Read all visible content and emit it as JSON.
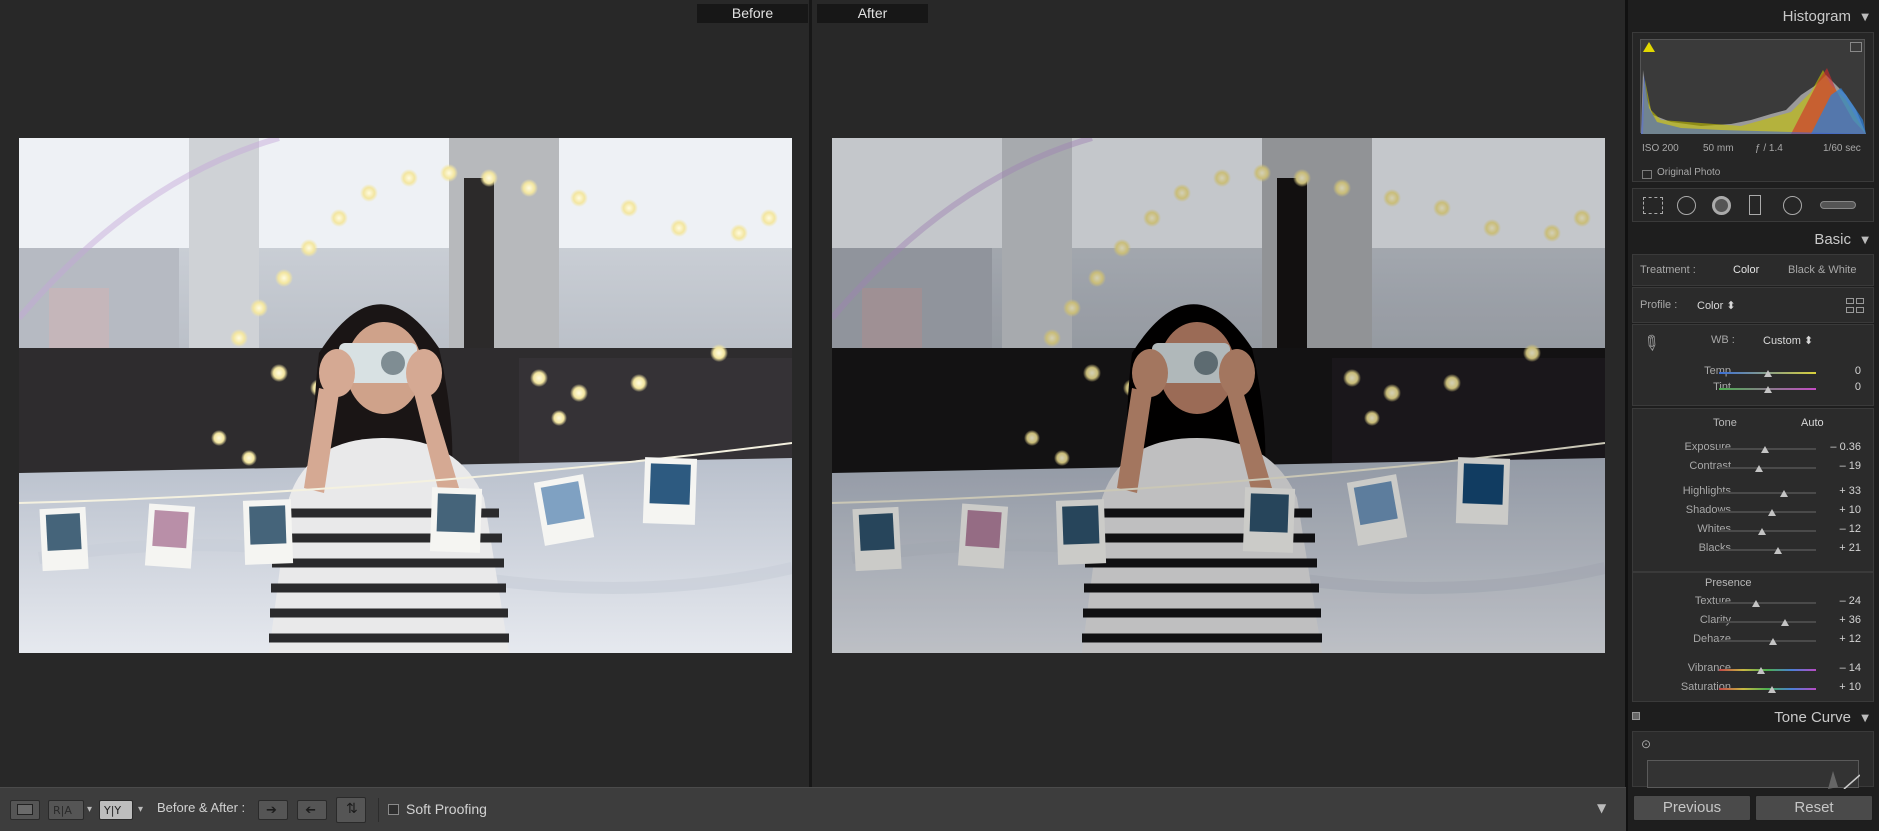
{
  "before_after": {
    "before_label": "Before",
    "after_label": "After"
  },
  "toolbar": {
    "before_after_label": "Before & After :",
    "soft_proofing_label": "Soft Proofing",
    "view_ra_label": "R|A",
    "view_yy_label": "Y|Y",
    "soft_proofing_checked": false
  },
  "histogram": {
    "title": "Histogram",
    "iso": "ISO 200",
    "focal": "50 mm",
    "aperture": "ƒ / 1.4",
    "shutter": "1/60 sec",
    "original_photo_label": "Original Photo"
  },
  "tools": [
    "crop-overlay-icon",
    "spot-removal-icon",
    "red-eye-icon",
    "graduated-filter-icon",
    "radial-filter-icon",
    "adjustment-brush-icon"
  ],
  "basic": {
    "title": "Basic",
    "treatment_label": "Treatment :",
    "treatment_color": "Color",
    "treatment_bw": "Black & White",
    "profile_label": "Profile :",
    "profile_value": "Color ⬍",
    "wb_label": "WB :",
    "wb_value": "Custom ⬍",
    "tone_label": "Tone",
    "auto_label": "Auto",
    "presence_label": "Presence",
    "wb_sliders": [
      {
        "label": "Temp",
        "value": "0",
        "level": 0.5
      },
      {
        "label": "Tint",
        "value": "0",
        "level": 0.5
      }
    ],
    "tone_sliders": [
      {
        "label": "Exposure",
        "value": "– 0.36",
        "level": 0.47
      },
      {
        "label": "Contrast",
        "value": "– 19",
        "level": 0.41
      }
    ],
    "tone_sliders2": [
      {
        "label": "Highlights",
        "value": "+ 33",
        "level": 0.67
      },
      {
        "label": "Shadows",
        "value": "+ 10",
        "level": 0.55
      },
      {
        "label": "Whites",
        "value": "– 12",
        "level": 0.44
      },
      {
        "label": "Blacks",
        "value": "+ 21",
        "level": 0.61
      }
    ],
    "presence_sliders": [
      {
        "label": "Texture",
        "value": "– 24",
        "level": 0.38
      },
      {
        "label": "Clarity",
        "value": "+ 36",
        "level": 0.68
      },
      {
        "label": "Dehaze",
        "value": "+ 12",
        "level": 0.56
      }
    ],
    "color_sliders": [
      {
        "label": "Vibrance",
        "value": "– 14",
        "level": 0.43
      },
      {
        "label": "Saturation",
        "value": "+ 10",
        "level": 0.55
      }
    ]
  },
  "tone_curve": {
    "title": "Tone Curve"
  },
  "footer": {
    "previous_label": "Previous",
    "reset_label": "Reset"
  },
  "colors": {
    "panel_bg": "#1e1e1e",
    "main_bg": "#282828",
    "toolbar_bg": "#3d3d3d"
  }
}
